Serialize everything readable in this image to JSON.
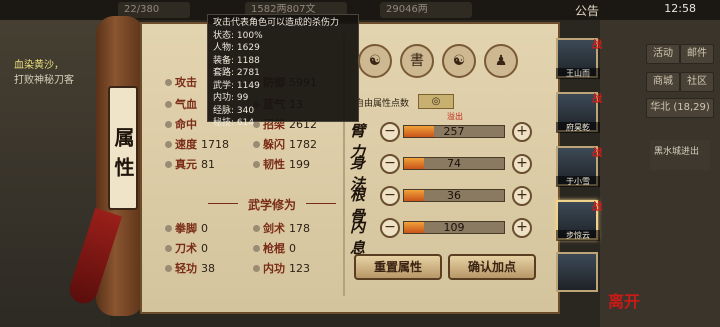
{
  "topbar": {
    "left_value": "22/380",
    "mid_value": "1582两807文",
    "currency": "29046两",
    "notice": "公告",
    "clock": "12:58"
  },
  "left_quest": {
    "title": "血染黄沙，",
    "desc": "打败神秘刀客"
  },
  "right_panel": {
    "buttons": [
      "活动",
      "邮件",
      "商城",
      "社区"
    ],
    "area": "华北",
    "coords": "(18,29)",
    "area_note": "黑水城进出"
  },
  "scroll_label": "属性",
  "tooltip": {
    "title": "攻击代表角色可以造成的杀伤力",
    "lines": [
      "状态: 100%",
      "人物: 1629",
      "装备: 1188",
      "套路: 2781",
      "武学: 1149",
      "内功: 99",
      "经脉: 340",
      "秘技: 614"
    ]
  },
  "stats": [
    {
      "label": "攻击",
      "value": ""
    },
    {
      "label": "防御",
      "value": "5991"
    },
    {
      "label": "气血",
      "value": ""
    },
    {
      "label": "蓝气",
      "value": "13"
    },
    {
      "label": "命中",
      "value": ""
    },
    {
      "label": "招架",
      "value": "2612"
    },
    {
      "label": "速度",
      "value": "1718"
    },
    {
      "label": "躲闪",
      "value": "1782"
    },
    {
      "label": "真元",
      "value": "81"
    },
    {
      "label": "韧性",
      "value": "199"
    }
  ],
  "wuxue": {
    "title": "武学修为",
    "items": [
      {
        "label": "拳脚",
        "value": "0"
      },
      {
        "label": "剑术",
        "value": "178"
      },
      {
        "label": "刀术",
        "value": "0"
      },
      {
        "label": "枪棍",
        "value": "0"
      },
      {
        "label": "轻功",
        "value": "38"
      },
      {
        "label": "内功",
        "value": "123"
      }
    ]
  },
  "allocation": {
    "tabs": [
      "role-icon",
      "book-icon",
      "yinyang-icon",
      "pose-icon"
    ],
    "free_points_label": "自由属性点数",
    "free_points_value": "◎",
    "overflow_tag": "溢出",
    "attributes": [
      {
        "name": "臂力",
        "value": "257",
        "fill": 0.3
      },
      {
        "name": "身法",
        "value": "74",
        "fill": 0.2
      },
      {
        "name": "根骨",
        "value": "36",
        "fill": 0.2
      },
      {
        "name": "内息",
        "value": "109",
        "fill": 0.2
      }
    ],
    "minus_symbol": "−",
    "plus_symbol": "+",
    "reset_label": "重置属性",
    "confirm_label": "确认加点"
  },
  "portraits": [
    {
      "name": "王山而",
      "badge": "战"
    },
    {
      "name": "府昊乾",
      "badge": "战"
    },
    {
      "name": "于小雪",
      "badge": "战"
    },
    {
      "name": "步惊云",
      "badge": "战"
    },
    {
      "name": "",
      "badge": ""
    }
  ],
  "bottom_stamp": "离开"
}
